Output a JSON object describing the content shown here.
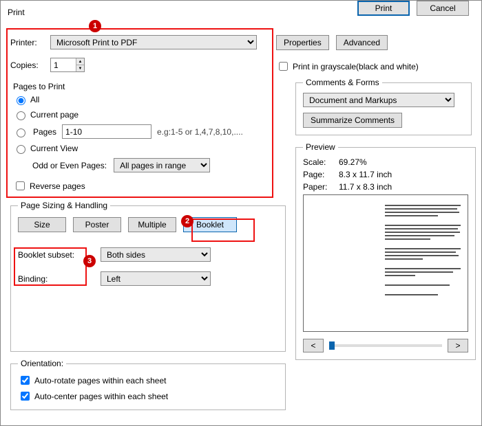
{
  "window": {
    "title": "Print"
  },
  "callouts": {
    "c1": "1",
    "c2": "2",
    "c3": "3"
  },
  "printer": {
    "label": "Printer:",
    "selected": "Microsoft Print to PDF",
    "copies_label": "Copies:",
    "copies_value": "1",
    "properties_btn": "Properties",
    "advanced_btn": "Advanced",
    "grayscale_label": "Print in grayscale(black and white)"
  },
  "pages": {
    "legend": "Pages to Print",
    "all": "All",
    "current": "Current page",
    "pages_label": "Pages",
    "pages_value": "1-10",
    "pages_hint": "e.g:1-5 or 1,4,7,8,10,....",
    "current_view": "Current View",
    "odd_even_label": "Odd or Even Pages:",
    "odd_even_value": "All pages in range",
    "reverse": "Reverse pages"
  },
  "sizing": {
    "legend": "Page Sizing & Handling",
    "size": "Size",
    "poster": "Poster",
    "multiple": "Multiple",
    "booklet": "Booklet",
    "subset_label": "Booklet subset:",
    "subset_value": "Both sides",
    "binding_label": "Binding:",
    "binding_value": "Left"
  },
  "orientation": {
    "legend": "Orientation:",
    "auto_rotate": "Auto-rotate pages within each sheet",
    "auto_center": "Auto-center pages within each sheet"
  },
  "comments": {
    "legend": "Comments & Forms",
    "value": "Document and Markups",
    "summarize_btn": "Summarize Comments"
  },
  "preview": {
    "legend": "Preview",
    "scale_label": "Scale:",
    "scale_value": "69.27%",
    "page_label": "Page:",
    "page_value": "8.3 x 11.7 inch",
    "paper_label": "Paper:",
    "paper_value": "11.7 x 8.3 inch",
    "prev": "<",
    "next": ">"
  },
  "footer": {
    "print": "Print",
    "cancel": "Cancel"
  }
}
